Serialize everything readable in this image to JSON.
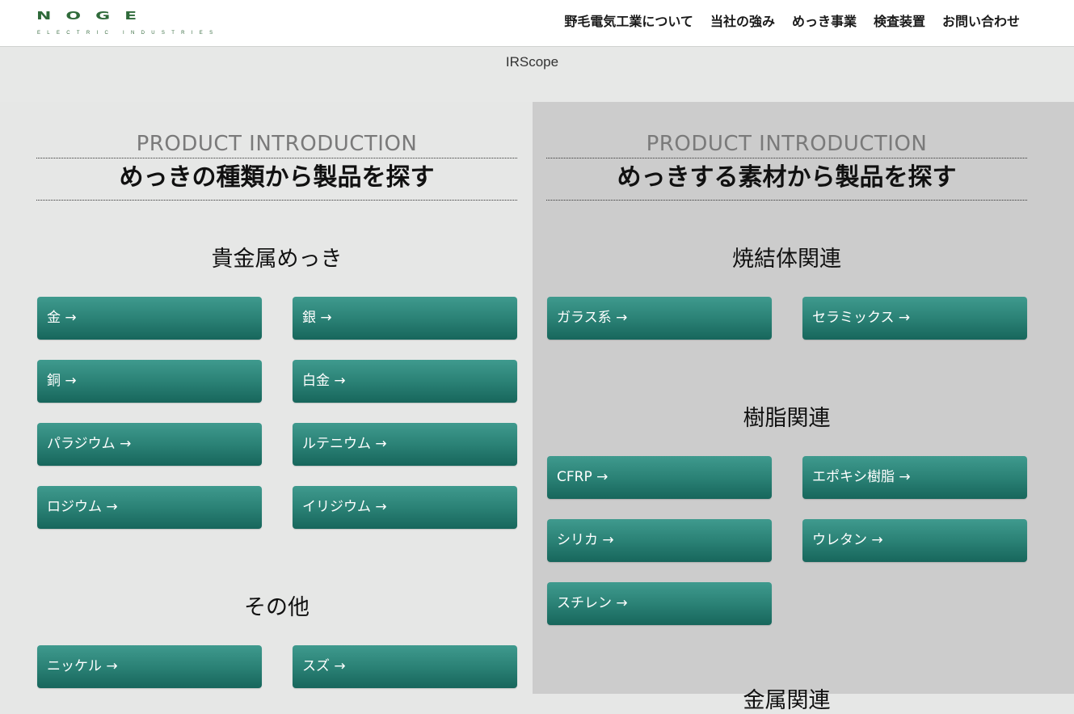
{
  "header": {
    "logo_text": "NOGE",
    "logo_subtext": "ELECTRIC INDUSTRIES",
    "nav": [
      "野毛電気工業について",
      "当社の強み",
      "めっき事業",
      "検査装置",
      "お問い合わせ"
    ]
  },
  "breadcrumb": "IRScope",
  "left": {
    "eyebrow": "PRODUCT INTRODUCTION",
    "title": "めっきの種類から製品を探す",
    "categories": [
      {
        "title": "貴金属めっき",
        "items": [
          "金 →",
          "銀 →",
          "銅 →",
          "白金 →",
          "パラジウム →",
          "ルテニウム →",
          "ロジウム →",
          "イリジウム →"
        ]
      },
      {
        "title": "その他",
        "items": [
          "ニッケル →",
          "スズ →"
        ]
      }
    ]
  },
  "right": {
    "eyebrow": "PRODUCT INTRODUCTION",
    "title": "めっきする素材から製品を探す",
    "categories": [
      {
        "title": "焼結体関連",
        "items": [
          "ガラス系 →",
          "セラミックス →"
        ]
      },
      {
        "title": "樹脂関連",
        "items": [
          "CFRP →",
          "エポキシ樹脂 →",
          "シリカ →",
          "ウレタン →",
          "スチレン →"
        ]
      },
      {
        "title": "金属関連",
        "items": []
      }
    ]
  },
  "colors": {
    "button_top": "#3f9a8e",
    "button_bottom": "#17665c",
    "logo_green": "#2f6a3a",
    "right_panel": "#cccccc",
    "left_panel": "#e6e7e6"
  }
}
